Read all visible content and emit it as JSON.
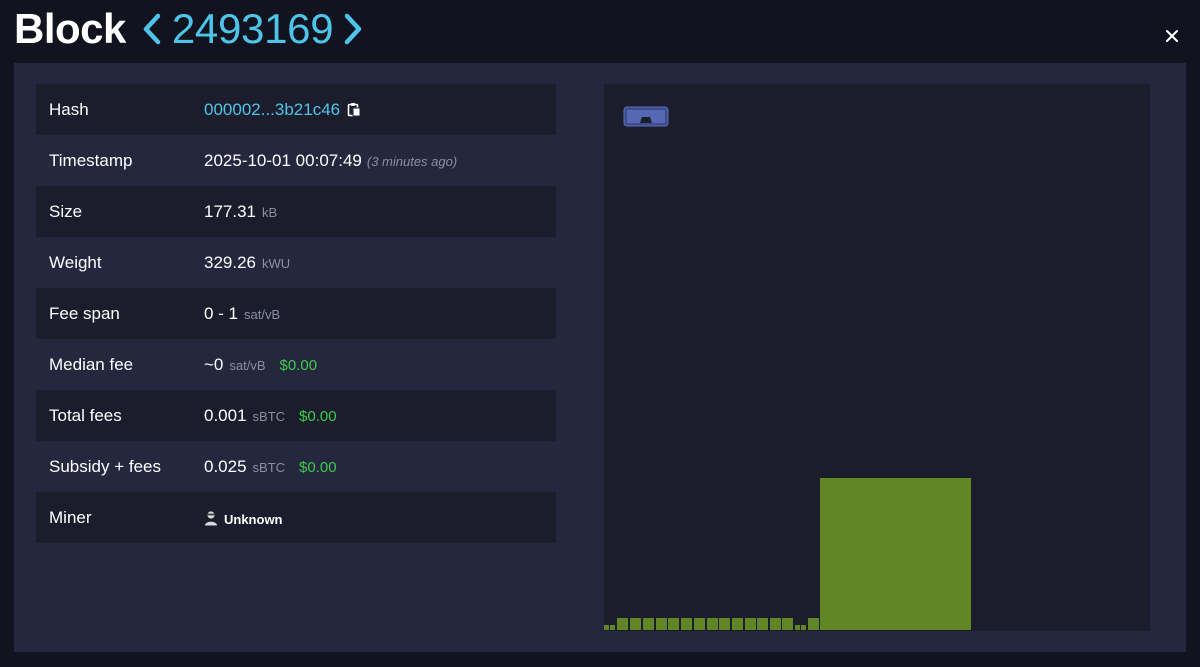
{
  "header": {
    "title": "Block",
    "block_height": "2493169"
  },
  "details": {
    "rows": [
      {
        "label": "Hash",
        "value": "000002...3b21c46"
      },
      {
        "label": "Timestamp",
        "value": "2025-10-01 00:07:49",
        "note": "(3 minutes ago)"
      },
      {
        "label": "Size",
        "value": "177.31",
        "unit": "kB"
      },
      {
        "label": "Weight",
        "value": "329.26",
        "unit": "kWU"
      },
      {
        "label": "Fee span",
        "value": "0 - 1",
        "unit": "sat/vB"
      },
      {
        "label": "Median fee",
        "value": "~0",
        "unit": "sat/vB",
        "fiat": "$0.00"
      },
      {
        "label": "Total fees",
        "value": "0.001",
        "unit": "sBTC",
        "fiat": "$0.00"
      },
      {
        "label": "Subsidy + fees",
        "value": "0.025",
        "unit": "sBTC",
        "fiat": "$0.00"
      },
      {
        "label": "Miner",
        "value": "Unknown"
      }
    ]
  },
  "block_visualization": {
    "fee_color": "#618625",
    "background": "#1b1d2c",
    "icon": "goggles-icon"
  },
  "colors": {
    "accent": "#4fc4ea",
    "fiat": "#3bcc49",
    "panel": "#24273e",
    "background": "#11131f"
  }
}
